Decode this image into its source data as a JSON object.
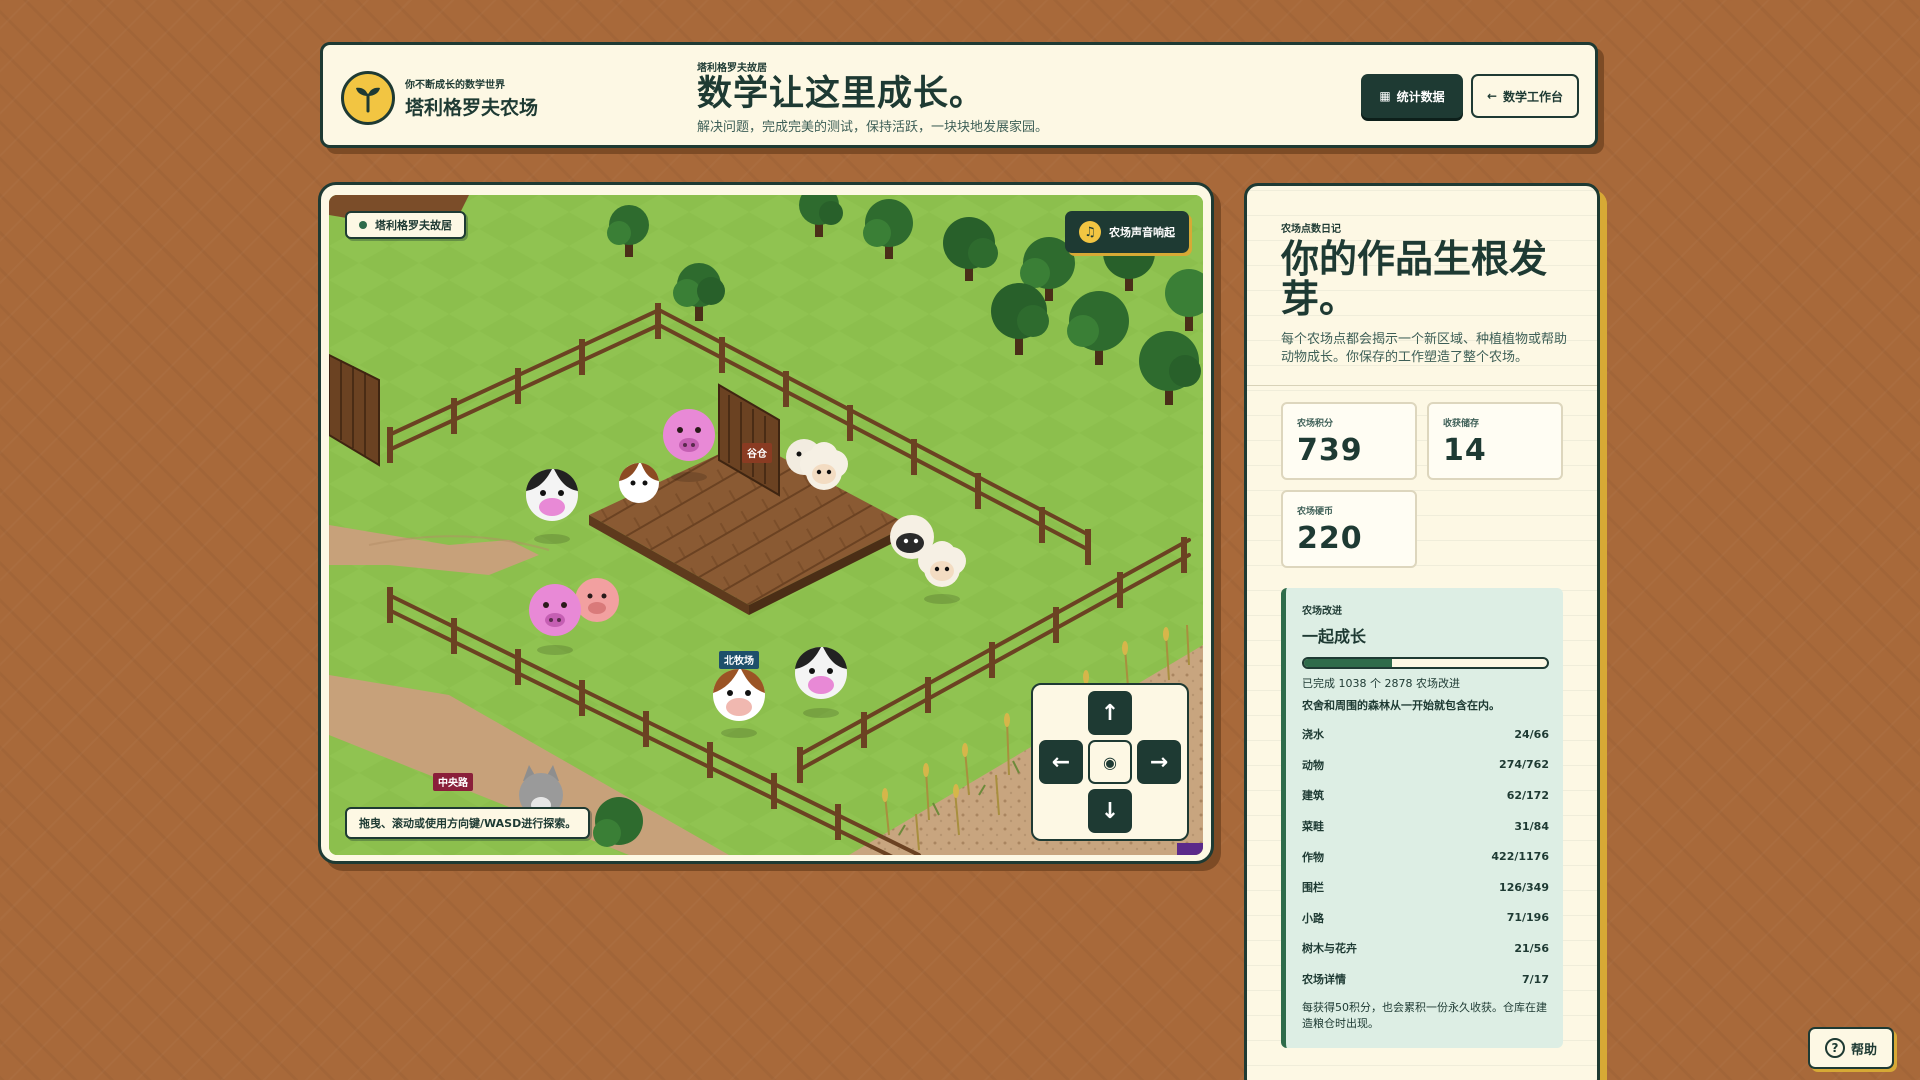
{
  "header": {
    "brand_subtitle": "你不断成长的数学世界",
    "brand_title": "塔利格罗夫农场",
    "eyebrow": "塔利格罗夫故居",
    "title": "数学让这里成长。",
    "description": "解决问题，完成完美的测试，保持活跃，一块块地发展家园。",
    "stats_button": "统计数据",
    "back_button": "数学工作台",
    "back_arrow": "←",
    "stats_icon": "▦"
  },
  "game": {
    "location_chip": "塔利格罗夫故居",
    "sound_chip": "农场声音响起",
    "sound_icon": "♫",
    "hint": "拖曳、滚动或使用方向键/WASD进行探索。",
    "labels": {
      "barn": "谷仓",
      "north_pasture": "北牧场",
      "central_road": "中央路"
    },
    "dpad": {
      "up": "↑",
      "left": "←",
      "center": "◉",
      "right": "→",
      "down": "↓"
    }
  },
  "panel": {
    "eyebrow": "农场点数日记",
    "title": "你的作品生根发芽。",
    "description": "每个农场点都会揭示一个新区域、种植植物或帮助动物成长。你保存的工作塑造了整个农场。",
    "stats": [
      {
        "label": "农场积分",
        "value": "739"
      },
      {
        "label": "收获储存",
        "value": "14"
      },
      {
        "label": "农场硬币",
        "value": "220"
      }
    ],
    "improve": {
      "eyebrow": "农场改进",
      "title": "一起成长",
      "progress_fraction": 0.3607,
      "count_text": "已完成 1038 个 2878 农场改进",
      "note": "农舍和周围的森林从一开始就包含在内。",
      "categories": [
        {
          "name": "浇水",
          "value": "24/66"
        },
        {
          "name": "动物",
          "value": "274/762"
        },
        {
          "name": "建筑",
          "value": "62/172"
        },
        {
          "name": "菜畦",
          "value": "31/84"
        },
        {
          "name": "作物",
          "value": "422/1176"
        },
        {
          "name": "围栏",
          "value": "126/349"
        },
        {
          "name": "小路",
          "value": "71/196"
        },
        {
          "name": "树木与花卉",
          "value": "21/56"
        },
        {
          "name": "农场详情",
          "value": "7/17"
        }
      ],
      "footer": "每获得50积分，也会累积一份永久收获。仓库在建造粮仓时出现。"
    }
  },
  "help": {
    "label": "帮助",
    "icon": "?"
  },
  "colors": {
    "background": "#a8693a",
    "dark_green": "#1e3a33",
    "cream": "#fdf8e4",
    "gold": "#f2c542",
    "grass": "#8cbf4d"
  }
}
